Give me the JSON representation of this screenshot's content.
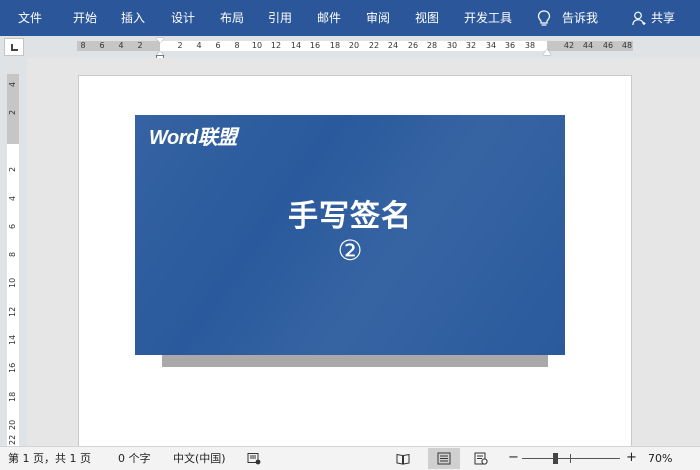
{
  "ribbon": {
    "tabs": [
      "文件",
      "开始",
      "插入",
      "设计",
      "布局",
      "引用",
      "邮件",
      "审阅",
      "视图",
      "开发工具"
    ],
    "tell_me": "告诉我",
    "share": "共享",
    "background": "#2b579a"
  },
  "ruler": {
    "horizontal_labels": [
      "8",
      "6",
      "4",
      "2",
      "2",
      "4",
      "6",
      "8",
      "10",
      "12",
      "14",
      "16",
      "18",
      "20",
      "22",
      "24",
      "26",
      "28",
      "30",
      "32",
      "34",
      "36",
      "38",
      "42",
      "44",
      "46",
      "48"
    ],
    "vertical_labels": [
      "4",
      "2",
      "2",
      "4",
      "6",
      "8",
      "10",
      "12",
      "14",
      "16",
      "18",
      "20",
      "22"
    ]
  },
  "slide": {
    "logo": "Word联盟",
    "title": "手写签名",
    "number": "②",
    "color": "#2a5a9d"
  },
  "status": {
    "page_info": "第 1 页，共 1 页",
    "word_count": "0 个字",
    "language": "中文(中国)",
    "zoom": "70%",
    "zoom_level_percent": 70
  },
  "icons": [
    "lightbulb-icon",
    "person-icon",
    "tab-stop-icon",
    "macro-record-icon",
    "read-mode-icon",
    "print-layout-icon",
    "web-layout-icon"
  ]
}
